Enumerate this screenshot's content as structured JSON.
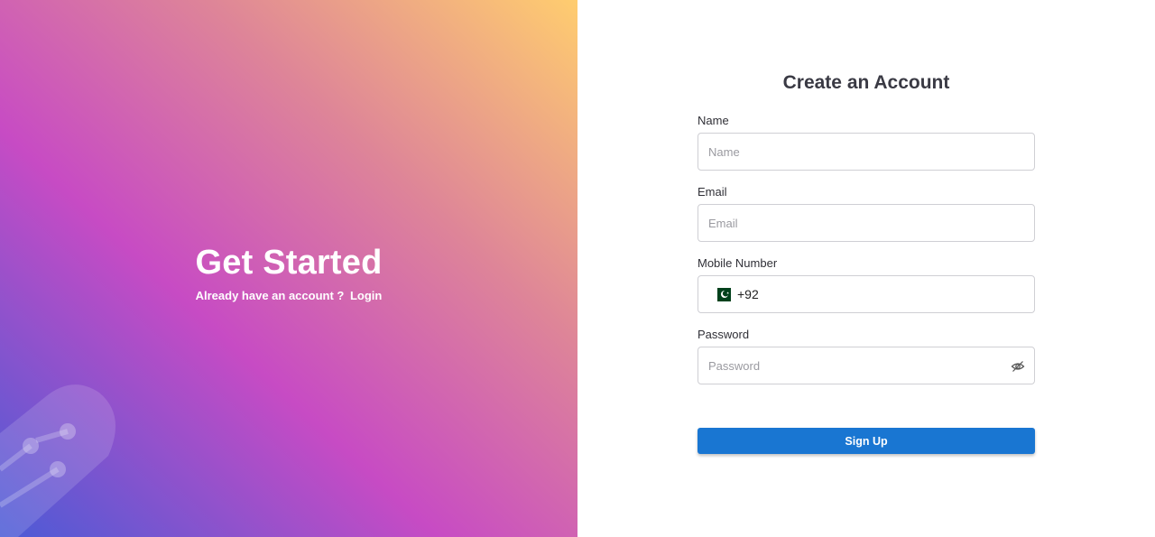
{
  "hero": {
    "title": "Get Started",
    "subtitle": "Already have an account ?",
    "login_link": "Login"
  },
  "form": {
    "title": "Create an Account",
    "name": {
      "label": "Name",
      "placeholder": "Name",
      "value": ""
    },
    "email": {
      "label": "Email",
      "placeholder": "Email",
      "value": ""
    },
    "mobile": {
      "label": "Mobile Number",
      "country_flag": "pakistan-flag-icon",
      "dial_code": "+92",
      "value": ""
    },
    "password": {
      "label": "Password",
      "placeholder": "Password",
      "value": "",
      "toggle_icon": "eye-slash-icon"
    },
    "submit_label": "Sign Up"
  },
  "colors": {
    "gradient": [
      "#4a5bd6",
      "#c74bc4",
      "#de8598",
      "#ffcd6f"
    ],
    "primary_button": "#1976d2",
    "title_text": "#3a3a44"
  }
}
